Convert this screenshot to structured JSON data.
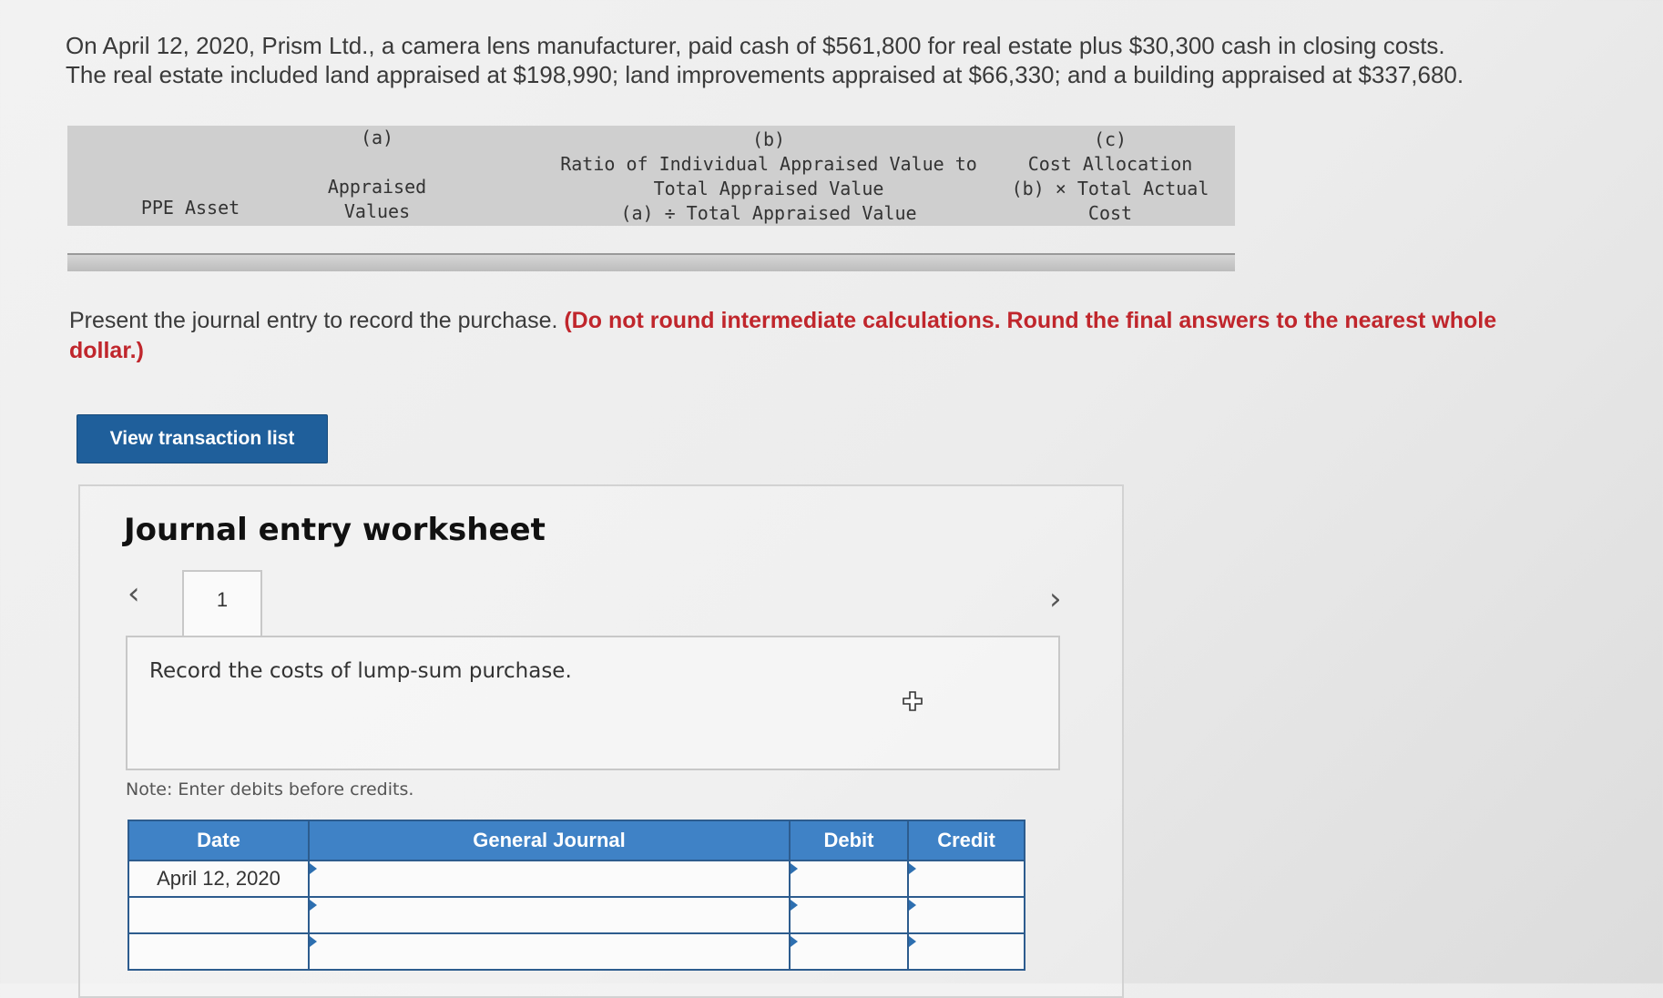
{
  "problem": {
    "line1": "On April 12, 2020, Prism Ltd., a camera lens manufacturer, paid cash of $561,800 for real estate plus $30,300 cash in closing costs.",
    "line2": "The real estate included land appraised at $198,990; land improvements appraised at $66,330; and a building appraised at $337,680."
  },
  "allocation_table": {
    "col_asset": "PPE Asset",
    "col_a": {
      "letter": "(a)",
      "line1": "Appraised",
      "line2": "Values"
    },
    "col_b": {
      "letter": "(b)",
      "line1": "Ratio of Individual Appraised Value to",
      "line2": "Total Appraised Value",
      "line3": "(a) ÷ Total Appraised Value"
    },
    "col_c": {
      "letter": "(c)",
      "line1": "Cost Allocation",
      "line2": "(b) × Total Actual",
      "line3": "Cost"
    }
  },
  "instruction": {
    "text": "Present the journal entry to record the purchase. ",
    "emphasis": "(Do not round intermediate calculations. Round the final answers to the nearest whole dollar.)"
  },
  "view_button": "View transaction list",
  "worksheet": {
    "title": "Journal entry worksheet",
    "prev_icon": "chevron-left-icon",
    "next_icon": "chevron-right-icon",
    "tab_label": "1",
    "description": "Record the costs of lump-sum purchase.",
    "note": "Note: Enter debits before credits.",
    "columns": {
      "date": "Date",
      "general_journal": "General Journal",
      "debit": "Debit",
      "credit": "Credit"
    },
    "rows": [
      {
        "date": "April 12, 2020"
      },
      {
        "date": ""
      },
      {
        "date": ""
      }
    ]
  }
}
